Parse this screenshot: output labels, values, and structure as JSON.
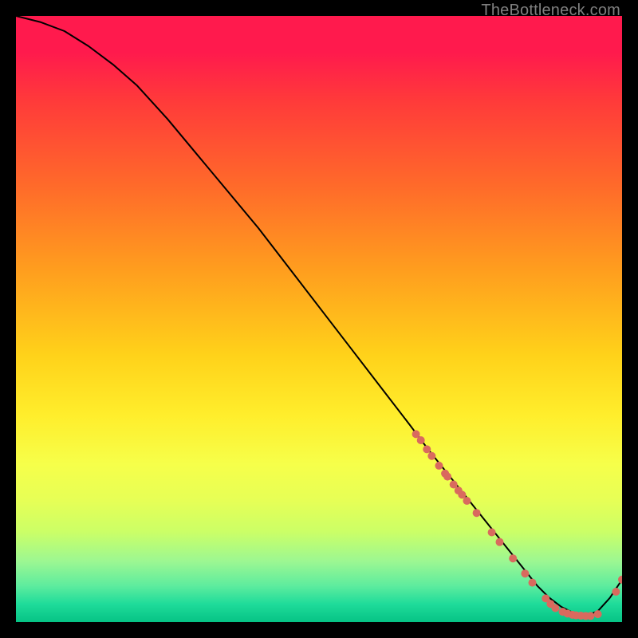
{
  "watermark": "TheBottleneck.com",
  "chart_data": {
    "type": "line",
    "title": "",
    "xlabel": "",
    "ylabel": "",
    "xlim": [
      0,
      100
    ],
    "ylim": [
      0,
      100
    ],
    "grid": false,
    "legend": false,
    "series": [
      {
        "name": "bottleneck-curve",
        "x": [
          0,
          4,
          8,
          12,
          16,
          20,
          25,
          30,
          35,
          40,
          45,
          50,
          55,
          60,
          65,
          68,
          70,
          72,
          74,
          76,
          78,
          80,
          82,
          84,
          86,
          88,
          90,
          92,
          94,
          96,
          98,
          100
        ],
        "y": [
          100,
          99,
          97.5,
          95,
          92,
          88.5,
          83,
          77,
          71,
          65,
          58.5,
          52,
          45.5,
          39,
          32.5,
          28.5,
          26,
          23.5,
          21,
          18.5,
          16,
          13.5,
          11,
          8.5,
          6,
          4,
          2.5,
          1.5,
          1,
          1.8,
          4,
          7
        ],
        "color": "#000000",
        "width": 2
      }
    ],
    "scatter": {
      "name": "highlight-points",
      "color": "#d96a5e",
      "radius": 5,
      "points": [
        {
          "x": 66,
          "y": 31
        },
        {
          "x": 66.8,
          "y": 30
        },
        {
          "x": 67.8,
          "y": 28.5
        },
        {
          "x": 68.6,
          "y": 27.4
        },
        {
          "x": 69.8,
          "y": 25.8
        },
        {
          "x": 70.8,
          "y": 24.5
        },
        {
          "x": 71.2,
          "y": 24
        },
        {
          "x": 72.2,
          "y": 22.7
        },
        {
          "x": 73,
          "y": 21.7
        },
        {
          "x": 73.6,
          "y": 21
        },
        {
          "x": 74.4,
          "y": 20
        },
        {
          "x": 76,
          "y": 18
        },
        {
          "x": 78.5,
          "y": 14.8
        },
        {
          "x": 79.8,
          "y": 13.2
        },
        {
          "x": 82,
          "y": 10.5
        },
        {
          "x": 84,
          "y": 8
        },
        {
          "x": 85.2,
          "y": 6.5
        },
        {
          "x": 87.4,
          "y": 3.9
        },
        {
          "x": 88.2,
          "y": 3
        },
        {
          "x": 89,
          "y": 2.3
        },
        {
          "x": 90.2,
          "y": 1.7
        },
        {
          "x": 91,
          "y": 1.4
        },
        {
          "x": 91.8,
          "y": 1.2
        },
        {
          "x": 92.4,
          "y": 1.1
        },
        {
          "x": 93.2,
          "y": 1.05
        },
        {
          "x": 94,
          "y": 1
        },
        {
          "x": 94.8,
          "y": 1
        },
        {
          "x": 96,
          "y": 1.3
        },
        {
          "x": 99,
          "y": 5
        },
        {
          "x": 100,
          "y": 7
        }
      ]
    },
    "background_gradient_stops": [
      {
        "pct": 0,
        "color": "#ff1a4d"
      },
      {
        "pct": 14,
        "color": "#ff3a3a"
      },
      {
        "pct": 28,
        "color": "#ff6a2a"
      },
      {
        "pct": 42,
        "color": "#ff9e1e"
      },
      {
        "pct": 56,
        "color": "#ffd21a"
      },
      {
        "pct": 74,
        "color": "#f6ff4a"
      },
      {
        "pct": 90,
        "color": "#9cf792"
      },
      {
        "pct": 100,
        "color": "#06c385"
      }
    ]
  }
}
